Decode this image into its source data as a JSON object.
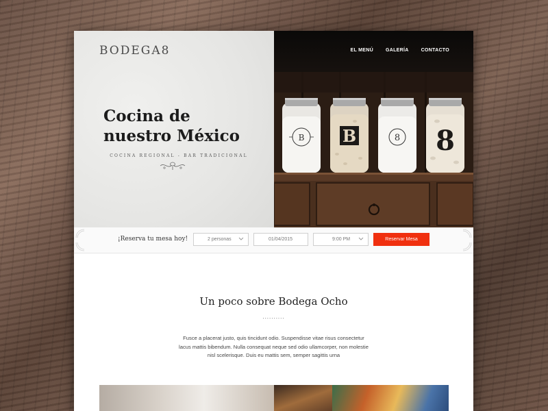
{
  "brand": {
    "logo": "BODEGA8"
  },
  "nav": {
    "items": [
      "EL MENÚ",
      "GALERÍA",
      "CONTACTO"
    ]
  },
  "hero": {
    "title_line1": "Cocina de",
    "title_line2": "nuestro México",
    "subtitle": "COCINA REGIONAL - BAR TRADICIONAL",
    "jar_labels": [
      "B",
      "8",
      "B",
      "8"
    ]
  },
  "reservation": {
    "label": "¡Reserva tu mesa hoy!",
    "people": "2 personas",
    "date": "01/04/2015",
    "time": "9:00 PM",
    "button": "Reservar Mesa"
  },
  "about": {
    "title": "Un poco sobre Bodega Ocho",
    "divider": "..........",
    "text": "Fusce a placerat justo, quis tincidunt odio. Suspendisse vitae risus consectetur lacus mattis bibendum. Nulla consequat neque sed odio ullamcorper, non molestie nisl scelerisque. Duis eu mattis sem, semper sagittis urna"
  },
  "colors": {
    "accent": "#f0300f",
    "dark_panel": "#0a0908",
    "text": "#1c1c1c"
  }
}
